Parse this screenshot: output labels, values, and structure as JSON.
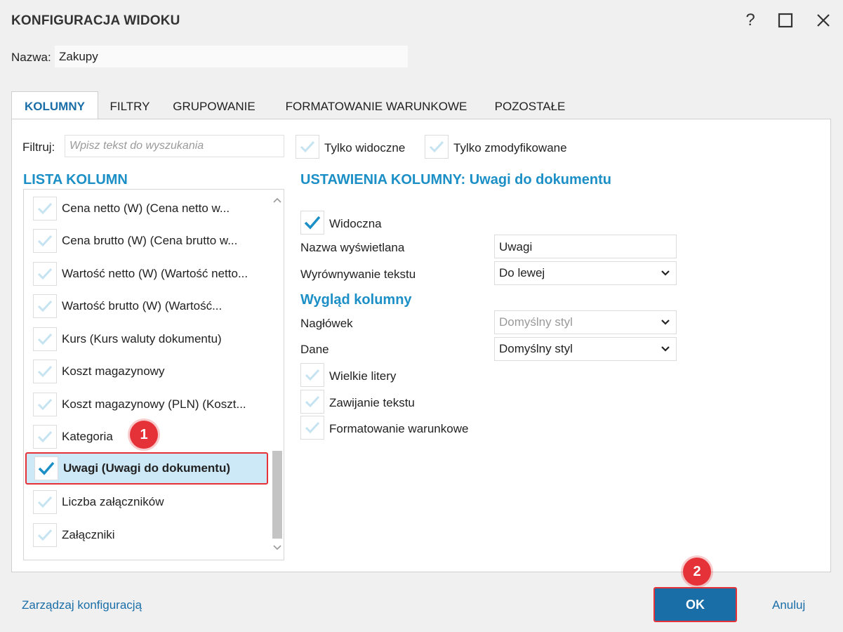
{
  "window": {
    "title": "KONFIGURACJA WIDOKU",
    "help_symbol": "?",
    "colors": {
      "accent": "#1a6ea8",
      "section": "#1b8fc6",
      "highlight": "#e53238",
      "selected_bg": "#cde8f6"
    }
  },
  "name": {
    "label": "Nazwa:",
    "value": "Zakupy"
  },
  "tabs": [
    {
      "label": "KOLUMNY",
      "active": true
    },
    {
      "label": "FILTRY",
      "active": false
    },
    {
      "label": "GRUPOWANIE",
      "active": false
    },
    {
      "label": "FORMATOWANIE WARUNKOWE",
      "active": false
    },
    {
      "label": "POZOSTAŁE",
      "active": false
    }
  ],
  "filter": {
    "label": "Filtruj:",
    "placeholder": "Wpisz tekst do wyszukania",
    "only_visible": "Tylko widoczne",
    "only_modified": "Tylko zmodyfikowane"
  },
  "column_list": {
    "title": "LISTA KOLUMN",
    "items": [
      {
        "label": "Cena netto (W) (Cena netto w...",
        "checked": false
      },
      {
        "label": "Cena brutto (W) (Cena brutto w...",
        "checked": false
      },
      {
        "label": "Wartość netto (W) (Wartość netto...",
        "checked": false
      },
      {
        "label": "Wartość brutto (W) (Wartość...",
        "checked": false
      },
      {
        "label": "Kurs (Kurs waluty dokumentu)",
        "checked": false
      },
      {
        "label": "Koszt magazynowy",
        "checked": false
      },
      {
        "label": "Koszt magazynowy (PLN) (Koszt...",
        "checked": false
      },
      {
        "label": "Kategoria",
        "checked": false
      },
      {
        "label": "Uwagi (Uwagi do dokumentu)",
        "checked": true,
        "selected": true
      },
      {
        "label": "Liczba załączników",
        "checked": false
      },
      {
        "label": "Załączniki",
        "checked": false
      }
    ]
  },
  "settings": {
    "title": "USTAWIENIA KOLUMNY: Uwagi do dokumentu",
    "visible_label": "Widoczna",
    "display_name_label": "Nazwa wyświetlana",
    "display_name_value": "Uwagi",
    "alignment_label": "Wyrównywanie tekstu",
    "alignment_value": "Do lewej",
    "appearance_title": "Wygląd kolumny",
    "header_label": "Nagłówek",
    "header_value": "Domyślny styl",
    "data_label": "Dane",
    "data_value": "Domyślny styl",
    "uppercase_label": "Wielkie litery",
    "wrap_label": "Zawijanie tekstu",
    "conditional_label": "Formatowanie warunkowe"
  },
  "callouts": {
    "one": "1",
    "two": "2"
  },
  "footer": {
    "manage_label": "Zarządzaj konfiguracją",
    "ok_label": "OK",
    "cancel_label": "Anuluj"
  }
}
